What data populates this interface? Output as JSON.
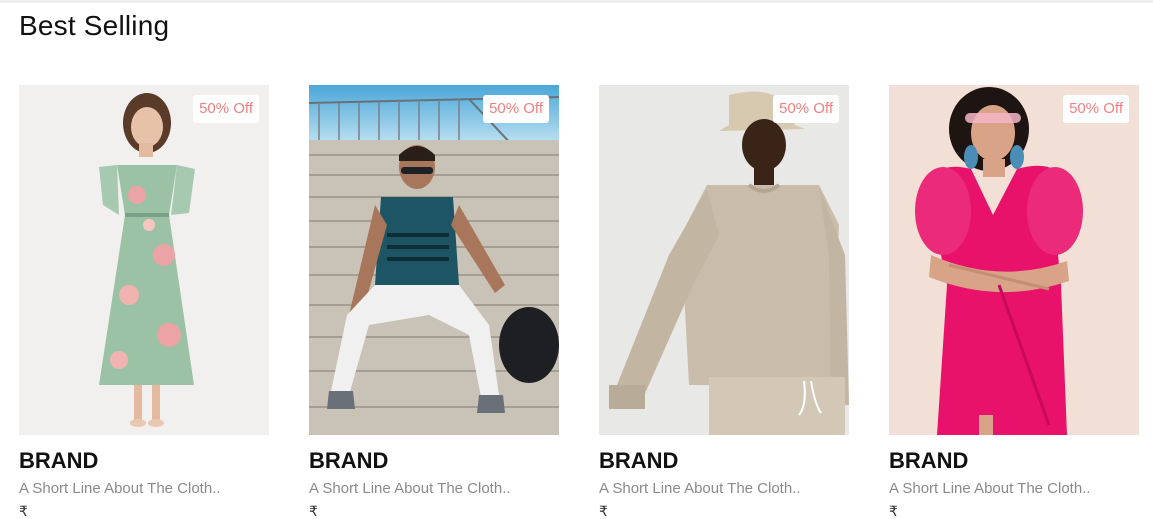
{
  "section": {
    "title": "Best Selling"
  },
  "products": [
    {
      "discount": "50% Off",
      "brand": "BRAND",
      "description": "A Short Line About The Cloth..",
      "price_currency": "₹",
      "image_icon": "product-image-floral-dress"
    },
    {
      "discount": "50% Off",
      "brand": "BRAND",
      "description": "A Short Line About The Cloth..",
      "price_currency": "₹",
      "image_icon": "product-image-mens-tshirt"
    },
    {
      "discount": "50% Off",
      "brand": "BRAND",
      "description": "A Short Line About The Cloth..",
      "price_currency": "₹",
      "image_icon": "product-image-sweatshirt"
    },
    {
      "discount": "50% Off",
      "brand": "BRAND",
      "description": "A Short Line About The Cloth..",
      "price_currency": "₹",
      "image_icon": "product-image-pink-dress"
    }
  ],
  "colors": {
    "badge_text": "#f08080",
    "brand_text": "#111111",
    "desc_text": "#8a8a8a"
  }
}
